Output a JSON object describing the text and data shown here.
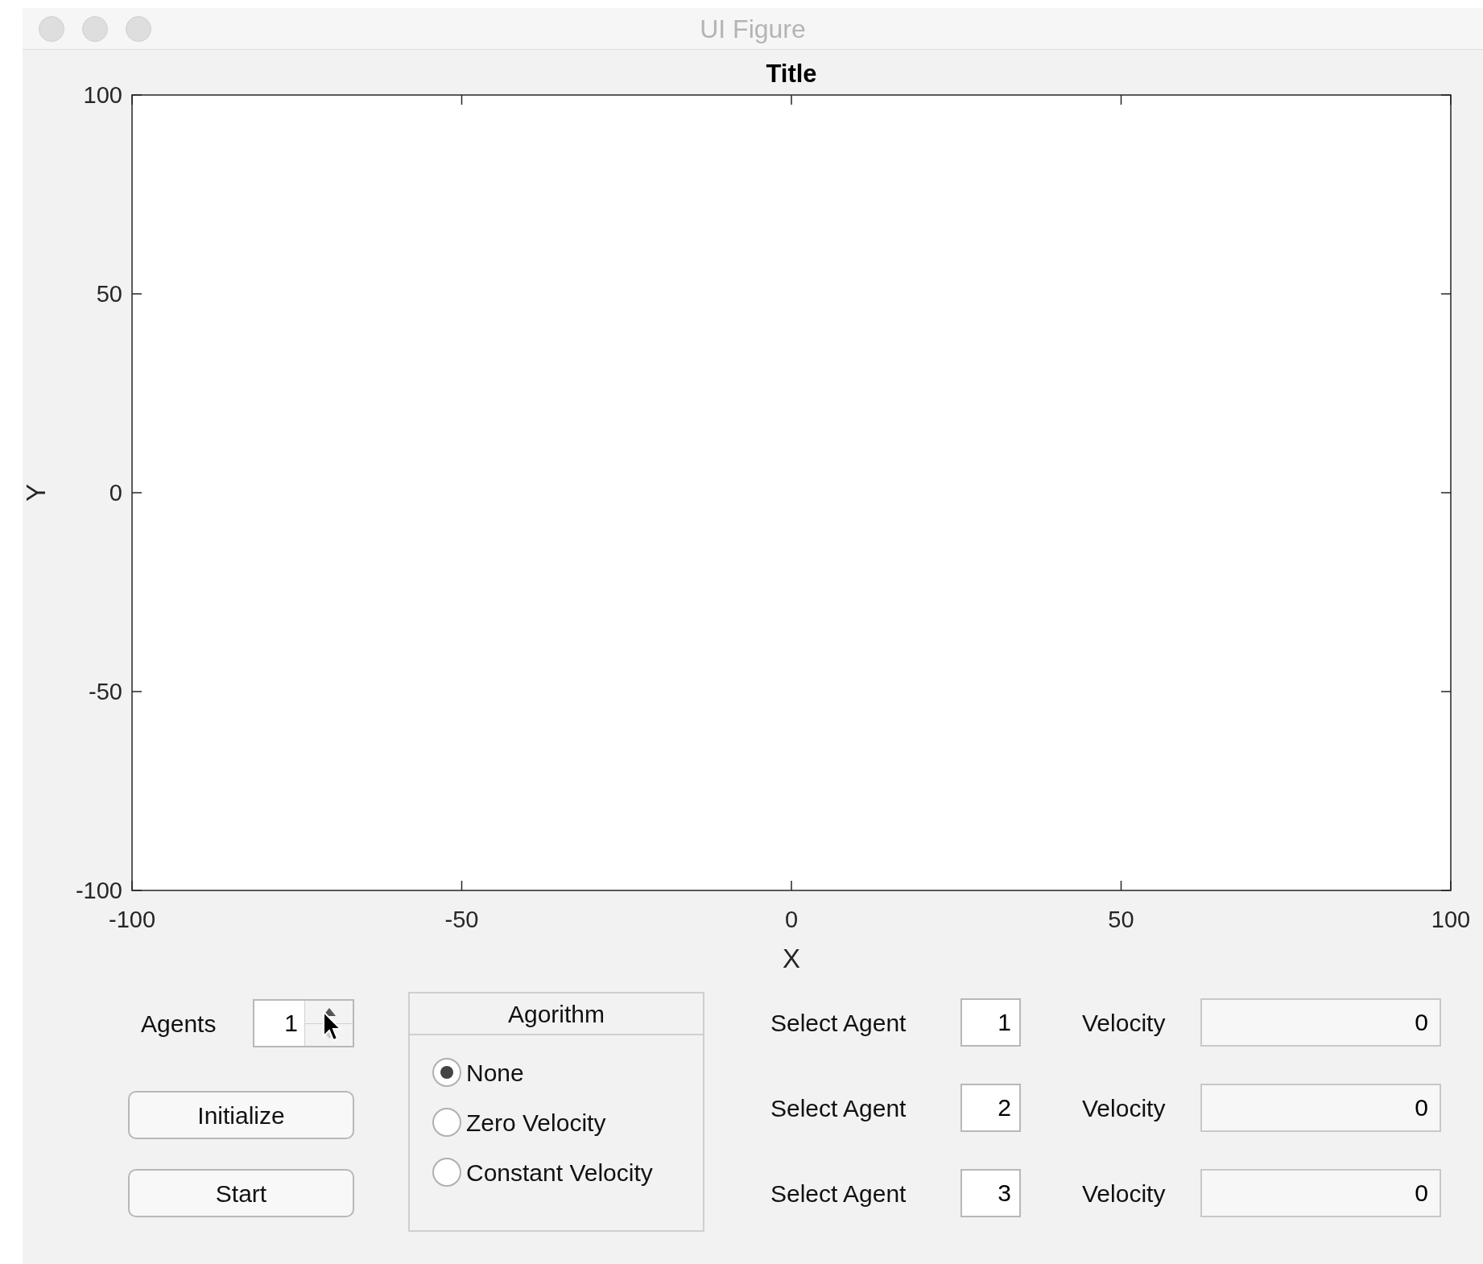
{
  "window": {
    "title": "UI Figure"
  },
  "chart": {
    "chart_data": {
      "type": "line",
      "title": "Title",
      "xlabel": "X",
      "ylabel": "Y",
      "xlim": [
        -100,
        100
      ],
      "ylim": [
        -100,
        100
      ],
      "xticks": [
        -100,
        -50,
        0,
        50,
        100
      ],
      "yticks": [
        -100,
        -50,
        0,
        50,
        100
      ]
    }
  },
  "agents": {
    "label": "Agents",
    "value": "1"
  },
  "buttons": [
    "Initialize",
    "Start"
  ],
  "algorithm": {
    "title": "Agorithm",
    "options": [
      {
        "label": "None",
        "selected": true
      },
      {
        "label": "Zero Velocity",
        "selected": false
      },
      {
        "label": "Constant Velocity",
        "selected": false
      }
    ]
  },
  "agent_rows": [
    {
      "label": "Select Agent",
      "value": "1",
      "velocity_label": "Velocity",
      "velocity": "0"
    },
    {
      "label": "Select Agent",
      "value": "2",
      "velocity_label": "Velocity",
      "velocity": "0"
    },
    {
      "label": "Select Agent",
      "value": "3",
      "velocity_label": "Velocity",
      "velocity": "0"
    }
  ]
}
